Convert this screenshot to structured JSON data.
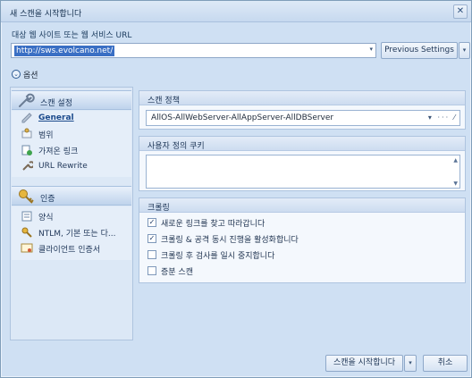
{
  "window": {
    "title": "새 스캔을 시작합니다",
    "close_glyph": "✕"
  },
  "url": {
    "label": "대상 웹 사이트 또는 웹 서비스 URL",
    "value": "http://sws.evolcano.net/",
    "dropdown_glyph": "▾",
    "previous_settings_label": "Previous Settings",
    "previous_settings_drop": "▾"
  },
  "options": {
    "label": "옵션",
    "toggle_glyph": "⌄"
  },
  "sidebar": {
    "scan_settings": {
      "label": "스캔 설정",
      "items": [
        {
          "label": "General"
        },
        {
          "label": "범위"
        },
        {
          "label": "가져온 링크"
        },
        {
          "label": "URL Rewrite"
        }
      ]
    },
    "auth": {
      "label": "인증",
      "items": [
        {
          "label": "양식"
        },
        {
          "label": "NTLM, 기본 또는 다..."
        },
        {
          "label": "클라이언트 인증서"
        }
      ]
    }
  },
  "scan_policy": {
    "header": "스캔 정책",
    "value": "AllOS-AllWebServer-AllAppServer-AllDBServer",
    "tools": "▾ ··· ⁄"
  },
  "cookies": {
    "header": "사용자 정의 쿠키",
    "scroll_up": "▲",
    "scroll_down": "▼"
  },
  "crawling": {
    "header": "크롤링",
    "options": [
      {
        "label": "새로운 링크를 찾고 따라갑니다",
        "checked": true
      },
      {
        "label": "크롤링 & 공격 동시 진행을 활성화합니다",
        "checked": true
      },
      {
        "label": "크롤링 후 검사를 일시 중지합니다",
        "checked": false
      },
      {
        "label": "증분 스캔",
        "checked": false
      }
    ],
    "check_glyph": "✓"
  },
  "footer": {
    "start_label": "스캔을 시작합니다",
    "start_drop": "▾",
    "cancel_label": "취소"
  },
  "colors": {
    "accent": "#3a6fc4",
    "panel": "#cfe0f3",
    "sidebar": "#dce8f6"
  }
}
